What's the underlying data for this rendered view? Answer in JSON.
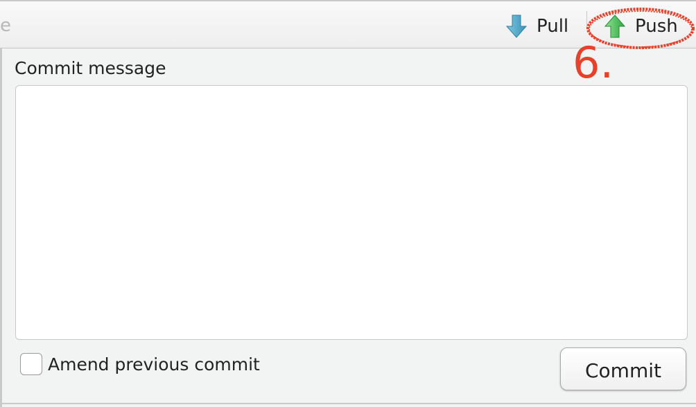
{
  "toolbar": {
    "faded_text": "e",
    "pull_label": "Pull",
    "push_label": "Push",
    "pull_icon": "arrow-down-icon",
    "push_icon": "arrow-up-icon",
    "pull_icon_color": "#4aa3c7",
    "push_icon_color": "#3fbf4f"
  },
  "annotation": {
    "step_number": "6.",
    "color": "#e8412a"
  },
  "commit_panel": {
    "message_label": "Commit message",
    "message_value": "",
    "amend_label": "Amend previous commit",
    "amend_checked": false,
    "commit_button_label": "Commit"
  }
}
